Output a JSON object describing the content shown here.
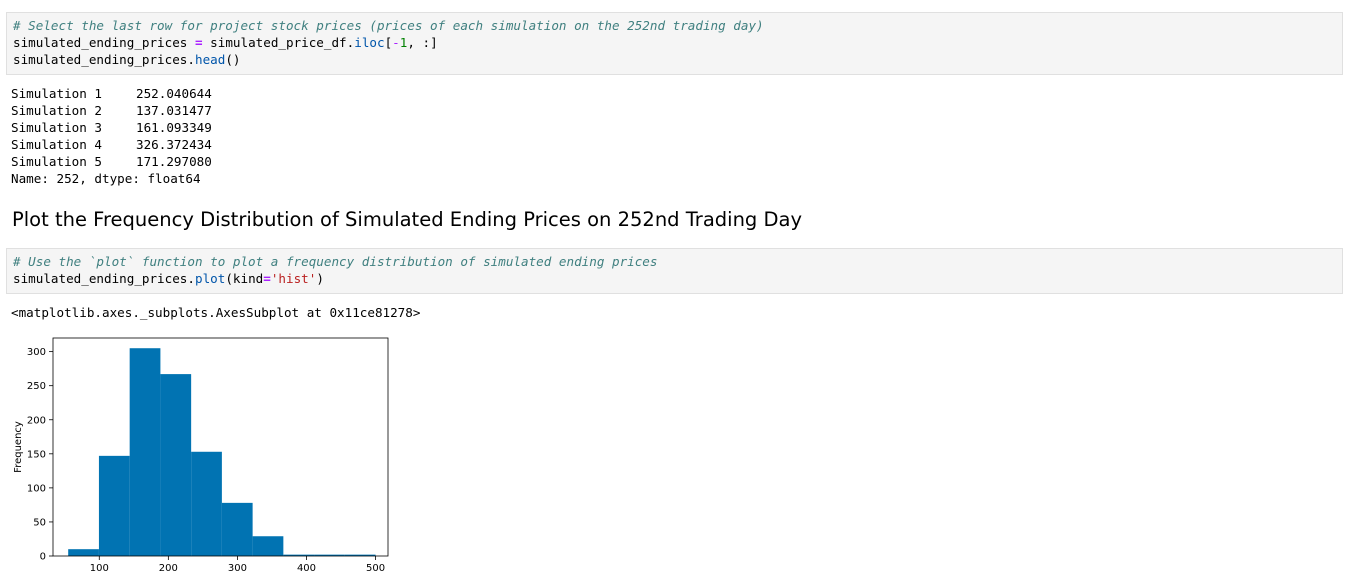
{
  "cell1": {
    "comment": "# Select the last row for project stock prices (prices of each simulation on the 252nd trading day)",
    "line2": {
      "var": "simulated_ending_prices ",
      "eq": "=",
      "rhs1": " simulated_price_df.",
      "iloc": "iloc",
      "br_open": "[",
      "minus": "-",
      "one": "1",
      "rest": ", :]"
    },
    "line3": {
      "obj": "simulated_ending_prices.",
      "fn": "head",
      "parens": "()"
    }
  },
  "output1": {
    "rows": [
      {
        "label": "Simulation 1",
        "value": "252.040644"
      },
      {
        "label": "Simulation 2",
        "value": "137.031477"
      },
      {
        "label": "Simulation 3",
        "value": "161.093349"
      },
      {
        "label": "Simulation 4",
        "value": "326.372434"
      },
      {
        "label": "Simulation 5",
        "value": "171.297080"
      }
    ],
    "footer": "Name: 252, dtype: float64"
  },
  "heading": "Plot the Frequency Distribution of Simulated Ending Prices on 252nd Trading Day",
  "cell2": {
    "comment": "# Use the `plot` function to plot a frequency distribution of simulated ending prices",
    "line2": {
      "obj": "simulated_ending_prices.",
      "fn": "plot",
      "open": "(kind",
      "eq": "=",
      "str": "'hist'",
      "close": ")"
    }
  },
  "output2": "<matplotlib.axes._subplots.AxesSubplot at 0x11ce81278>",
  "chart_data": {
    "type": "bar",
    "title": "",
    "xlabel": "",
    "ylabel": "Frequency",
    "bin_edges": [
      55,
      99.5,
      144,
      188.5,
      233,
      277.5,
      322,
      366.5,
      411,
      455.5,
      500
    ],
    "values": [
      10,
      147,
      305,
      267,
      153,
      78,
      29,
      2,
      2,
      2
    ],
    "xlim": [
      33,
      518
    ],
    "ylim": [
      0,
      320
    ],
    "xticks": [
      100,
      200,
      300,
      400,
      500
    ],
    "yticks": [
      0,
      50,
      100,
      150,
      200,
      250,
      300
    ],
    "bar_color": "#0173b2",
    "grid": false
  }
}
